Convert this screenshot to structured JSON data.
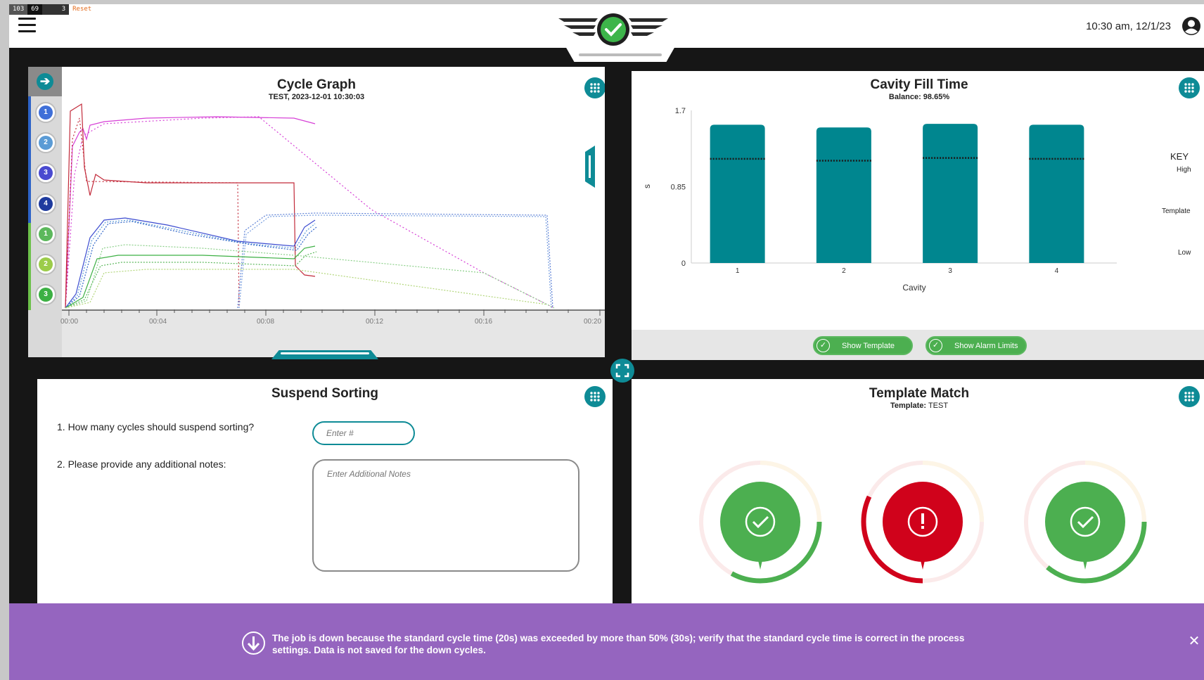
{
  "debug": {
    "c1": "103",
    "c2": "69",
    "c3": "3",
    "reset": "Reset"
  },
  "header": {
    "clock": "10:30 am, 12/1/23"
  },
  "cycle_graph": {
    "title": "Cycle Graph",
    "subtitle": "TEST, 2023-12-01   10:30:03",
    "channels": [
      "1",
      "2",
      "3",
      "4",
      "1",
      "2",
      "3"
    ],
    "time_ticks": [
      "00:00",
      "00:04",
      "00:08",
      "00:12",
      "00:16",
      "00:20"
    ]
  },
  "cavity_fill": {
    "title": "Cavity Fill Time",
    "subtitle": "Balance: 98.65%",
    "show_template_label": "Show Template",
    "show_alarm_limits_label": "Show Alarm Limits",
    "key": {
      "title": "KEY",
      "high": "High",
      "template": "Template",
      "low": "Low"
    }
  },
  "chart_data": {
    "type": "bar",
    "title": "Cavity Fill Time",
    "subtitle": "Balance: 98.65%",
    "xlabel": "Cavity",
    "ylabel": "s",
    "categories": [
      "1",
      "2",
      "3",
      "4"
    ],
    "values": [
      1.54,
      1.51,
      1.55,
      1.54
    ],
    "template": [
      1.16,
      1.14,
      1.17,
      1.16
    ],
    "ylim": [
      0,
      1.7
    ],
    "yticks": [
      "0",
      "0.85",
      "1.7"
    ],
    "colors": {
      "bar": "#00868f"
    }
  },
  "suspend_sorting": {
    "title": "Suspend Sorting",
    "q1": "1. How many cycles should suspend sorting?",
    "q1_placeholder": "Enter #",
    "q2": "2. Please provide any additional notes:",
    "q2_placeholder": "Enter Additional Notes"
  },
  "template_match": {
    "title": "Template Match",
    "template_label": "Template:",
    "template_value": "TEST",
    "gauges": [
      {
        "status": "ok",
        "fill": 0.33,
        "color": "#4caf50"
      },
      {
        "status": "alert",
        "fill": 0.32,
        "color": "#d0021b"
      },
      {
        "status": "ok",
        "fill": 0.36,
        "color": "#4caf50"
      }
    ]
  },
  "alert": {
    "line1": "The job is down because the standard cycle time (20s) was exceeded by more than 50% (30s); verify that the standard cycle time is correct in the process",
    "line2": "settings. Data is not saved for the down cycles."
  },
  "colors": {
    "accent": "#0e8b96",
    "ok": "#4caf50",
    "error": "#d0021b",
    "alert_bg": "#9565bf"
  }
}
